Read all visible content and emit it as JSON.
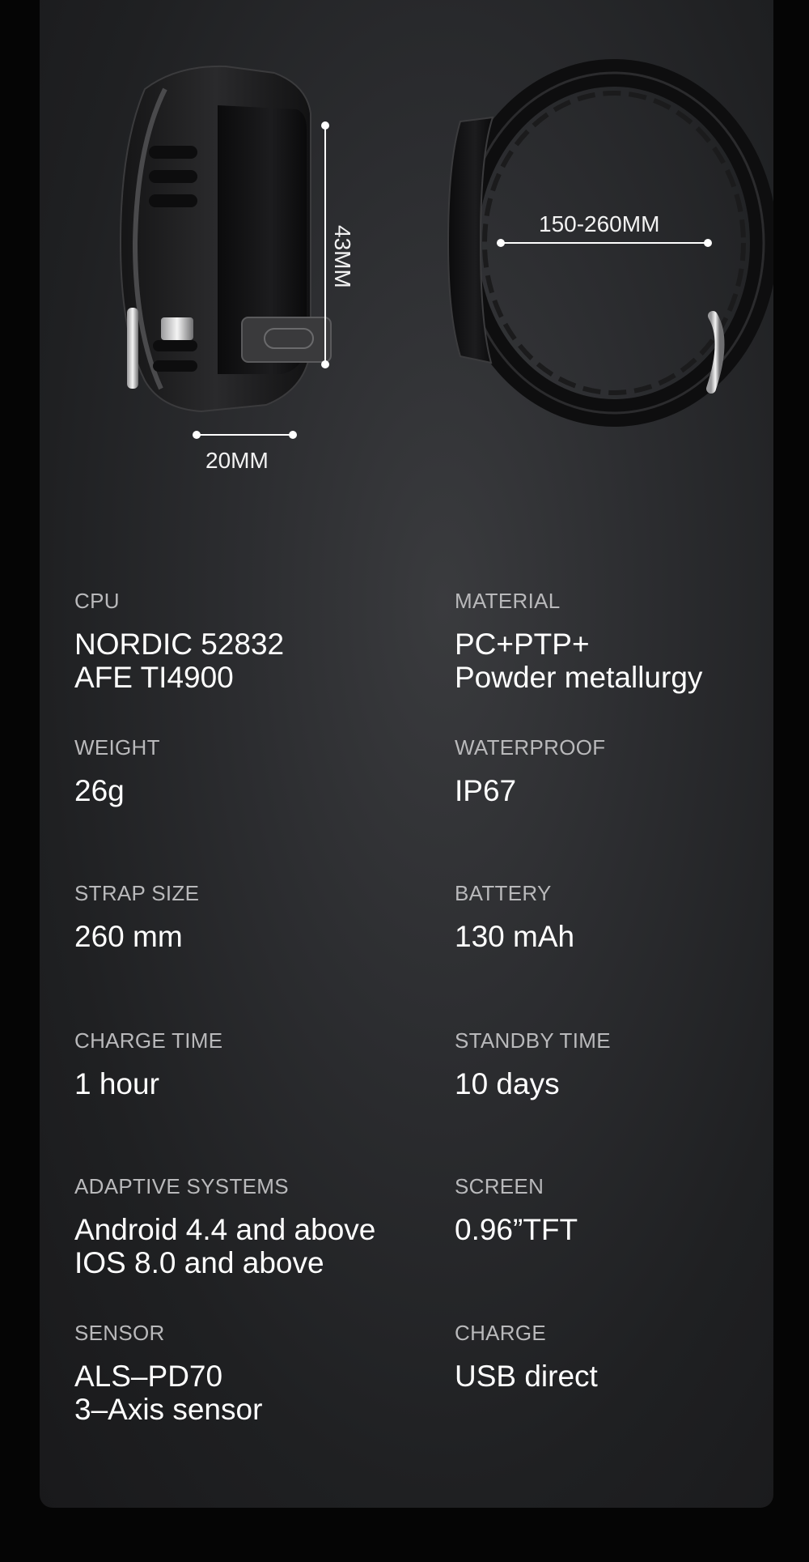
{
  "dimensions": {
    "width": "20MM",
    "height": "43MM",
    "circumference": "150-260MM"
  },
  "specs": [
    {
      "label": "CPU",
      "value_lines": [
        "NORDIC 52832",
        "AFE TI4900"
      ]
    },
    {
      "label": "MATERIAL",
      "value_lines": [
        "PC+PTP+",
        "Powder metallurgy"
      ]
    },
    {
      "label": "WEIGHT",
      "value_lines": [
        "26g"
      ]
    },
    {
      "label": "WATERPROOF",
      "value_lines": [
        "IP67"
      ]
    },
    {
      "label": "STRAP SIZE",
      "value_lines": [
        "260 mm"
      ]
    },
    {
      "label": "BATTERY",
      "value_lines": [
        "130 mAh"
      ]
    },
    {
      "label": "CHARGE TIME",
      "value_lines": [
        "1 hour"
      ]
    },
    {
      "label": "STANDBY TIME",
      "value_lines": [
        "10 days"
      ]
    },
    {
      "label": "ADAPTIVE SYSTEMS",
      "value_lines": [
        "Android 4.4 and above",
        "IOS 8.0 and above"
      ]
    },
    {
      "label": "SCREEN",
      "value_lines": [
        "0.96”TFT"
      ]
    },
    {
      "label": "SENSOR",
      "value_lines": [
        "ALS–PD70",
        "3–Axis sensor"
      ]
    },
    {
      "label": "CHARGE",
      "value_lines": [
        "USB direct"
      ]
    }
  ],
  "colors": {
    "page_background": "#050505",
    "panel_background": "#2c2d30",
    "label_text": "#b9b9bb",
    "value_text": "#ffffff"
  }
}
